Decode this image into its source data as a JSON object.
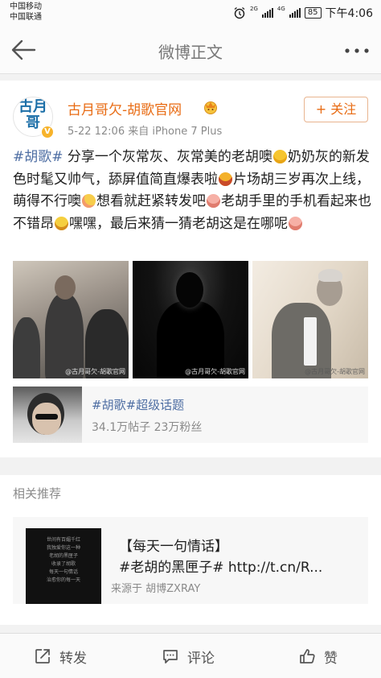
{
  "status_bar": {
    "carrier_1": "中国移动",
    "carrier_2": "中国联通",
    "network_1": "2G",
    "network_2": "4G",
    "battery": "85",
    "time": "下午4:06",
    "icons": [
      "alarm-icon",
      "signal-icon",
      "battery-icon"
    ]
  },
  "nav": {
    "title": "微博正文",
    "back_icon": "arrow-left-icon",
    "more_icon": "ellipsis-icon"
  },
  "post": {
    "avatar_text": "古月哥",
    "verified_badge": "V",
    "username": "古月哥欠-胡歌官网",
    "meta": "5-22 12:06  来自 iPhone 7 Plus",
    "follow_label": "+ 关注",
    "text": {
      "hashtag": "#胡歌#",
      "s1": " 分享一个灰常灰、灰常美的老胡噢",
      "s2": "奶奶灰的新发色时髦又帅气，舔屏值简直爆表啦",
      "s3": "片场胡三岁再次上线，萌得不行噢",
      "s4": "想看就赶紧转发吧",
      "s5": "老胡手里的手机看起来也不错昂",
      "s6": "嘿嘿，最后来猜一猜老胡这是在哪呢"
    },
    "photos": [
      {
        "watermark": "@古月哥欠-胡歌官网"
      },
      {
        "watermark": "@古月哥欠-胡歌官网"
      },
      {
        "watermark": "@古月哥欠-胡歌官网"
      }
    ],
    "topic": {
      "title": "#胡歌#超级话题",
      "stats": "34.1万帖子 23万粉丝"
    }
  },
  "related": {
    "heading": "相关推荐",
    "card": {
      "thumb_lines": [
        "世间有百媚千红",
        "我独爱你这一种",
        "老胡的黑匣子",
        "收录了胡歌",
        "每天一句情话",
        "治愈你的每一天"
      ],
      "title_line1": "【每天一句情话】",
      "title_line2": "#老胡的黑匣子# http://t.cn/R...",
      "source": "来源于 胡博ZXRAY"
    }
  },
  "actions": {
    "repost": "转发",
    "comment": "评论",
    "like": "赞"
  },
  "colors": {
    "username": "#e86b13",
    "hashtag": "#4e6ea3",
    "follow_border": "#e9b48f",
    "verified": "#f7b32b"
  }
}
